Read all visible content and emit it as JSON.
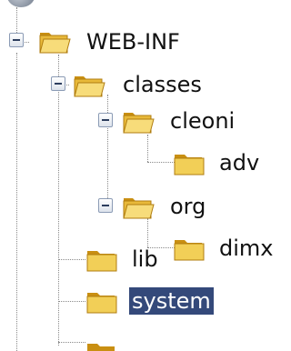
{
  "tree": {
    "nodes": [
      {
        "id": "web-inf",
        "label": "WEB-INF",
        "expanded": true,
        "selected": false
      },
      {
        "id": "classes",
        "label": "classes",
        "expanded": true,
        "selected": false
      },
      {
        "id": "cleoni",
        "label": "cleoni",
        "expanded": true,
        "selected": false
      },
      {
        "id": "adv",
        "label": "adv",
        "expanded": false,
        "selected": false
      },
      {
        "id": "org",
        "label": "org",
        "expanded": true,
        "selected": false
      },
      {
        "id": "dimx",
        "label": "dimx",
        "expanded": false,
        "selected": false
      },
      {
        "id": "lib",
        "label": "lib",
        "expanded": false,
        "selected": false
      },
      {
        "id": "system",
        "label": "system",
        "expanded": false,
        "selected": true
      }
    ]
  },
  "colors": {
    "folder_fill": "#f2cf57",
    "folder_dark": "#c98f12",
    "selection": "#34497a",
    "tree_line": "#8a8a8a"
  }
}
